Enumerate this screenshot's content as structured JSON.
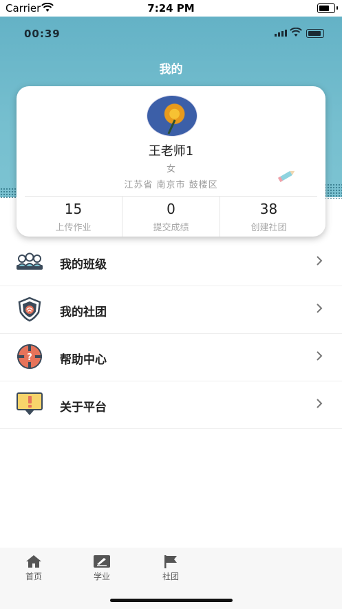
{
  "status_bar": {
    "carrier": "Carrier",
    "time": "7:24 PM"
  },
  "inner_status": {
    "time": "00:39"
  },
  "header": {
    "title": "我的"
  },
  "profile": {
    "name": "王老师1",
    "gender": "女",
    "location": "江苏省 南京市 鼓楼区",
    "stats": [
      {
        "value": "15",
        "label": "上传作业"
      },
      {
        "value": "0",
        "label": "提交成绩"
      },
      {
        "value": "38",
        "label": "创建社团"
      }
    ]
  },
  "menu": [
    {
      "label": "我的班级",
      "icon": "class-icon"
    },
    {
      "label": "我的社团",
      "icon": "club-shield-icon"
    },
    {
      "label": "帮助中心",
      "icon": "help-icon"
    },
    {
      "label": "关于平台",
      "icon": "about-icon"
    }
  ],
  "tabbar": [
    {
      "label": "首页",
      "icon": "home-icon"
    },
    {
      "label": "学业",
      "icon": "study-icon"
    },
    {
      "label": "社团",
      "icon": "flag-icon"
    }
  ],
  "colors": {
    "header": "#6fb9cb",
    "accent": "#e6735a"
  }
}
